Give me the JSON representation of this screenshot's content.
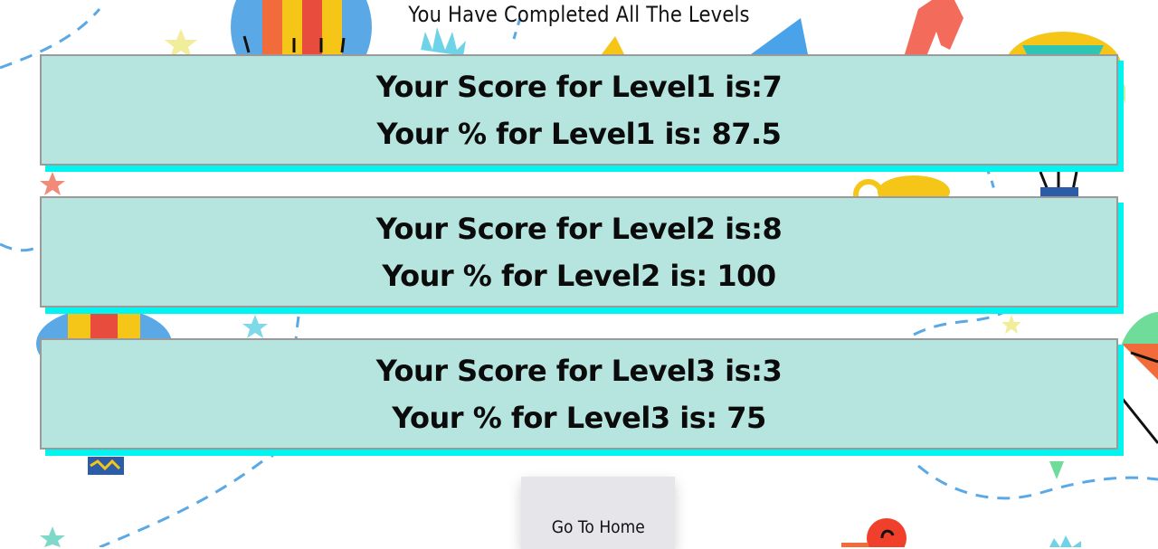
{
  "heading": "You Have Completed All The Levels",
  "levels": [
    {
      "score_text": "Your Score for Level1 is:7",
      "percent_text": "Your % for Level1 is: 87.5"
    },
    {
      "score_text": "Your Score for Level2 is:8",
      "percent_text": "Your % for Level2 is: 100"
    },
    {
      "score_text": "Your Score for Level3 is:3",
      "percent_text": "Your % for Level3 is: 75"
    }
  ],
  "home_button": "Go To Home",
  "colors": {
    "card_bg": "#b6e5e0",
    "card_shadow": "#00f5f0",
    "button_bg": "#e6e6ea"
  }
}
